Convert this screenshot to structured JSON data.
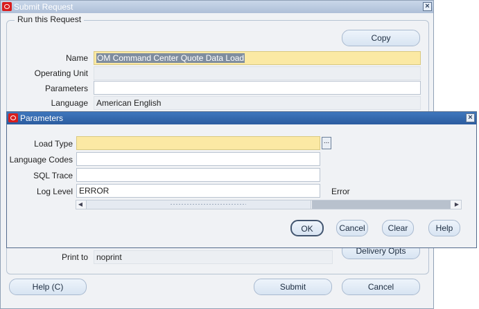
{
  "main_window": {
    "title": "Submit Request",
    "group_label": "Run this Request",
    "copy_button": "Copy",
    "fields": {
      "name_label": "Name",
      "name_value": "OM Command Center Quote Data Load",
      "operating_unit_label": "Operating Unit",
      "operating_unit_value": "",
      "parameters_label": "Parameters",
      "parameters_value": "",
      "language_label": "Language",
      "language_value": "American English",
      "print_to_label": "Print to",
      "print_to_value": "noprint"
    },
    "delivery_opts_button": "Delivery Opts",
    "help_button": "Help (C)",
    "submit_button": "Submit",
    "cancel_button": "Cancel"
  },
  "parameters_dialog": {
    "title": "Parameters",
    "load_type_label": "Load Type",
    "load_type_value": "",
    "language_codes_label": "Language Codes",
    "language_codes_value": "",
    "sql_trace_label": "SQL Trace",
    "sql_trace_value": "",
    "log_level_label": "Log Level",
    "log_level_value": "ERROR",
    "log_level_desc": "Error",
    "ellipsis": "...",
    "ok_button": "OK",
    "cancel_button": "Cancel",
    "clear_button": "Clear",
    "help_button": "Help"
  },
  "icons": {
    "window_icon": "oracle-logo-icon",
    "close": "close-icon"
  },
  "colors": {
    "required_field": "#fbe9a4",
    "dialog_titlebar": "#2b5c9f",
    "main_titlebar": "#aebfd8"
  }
}
